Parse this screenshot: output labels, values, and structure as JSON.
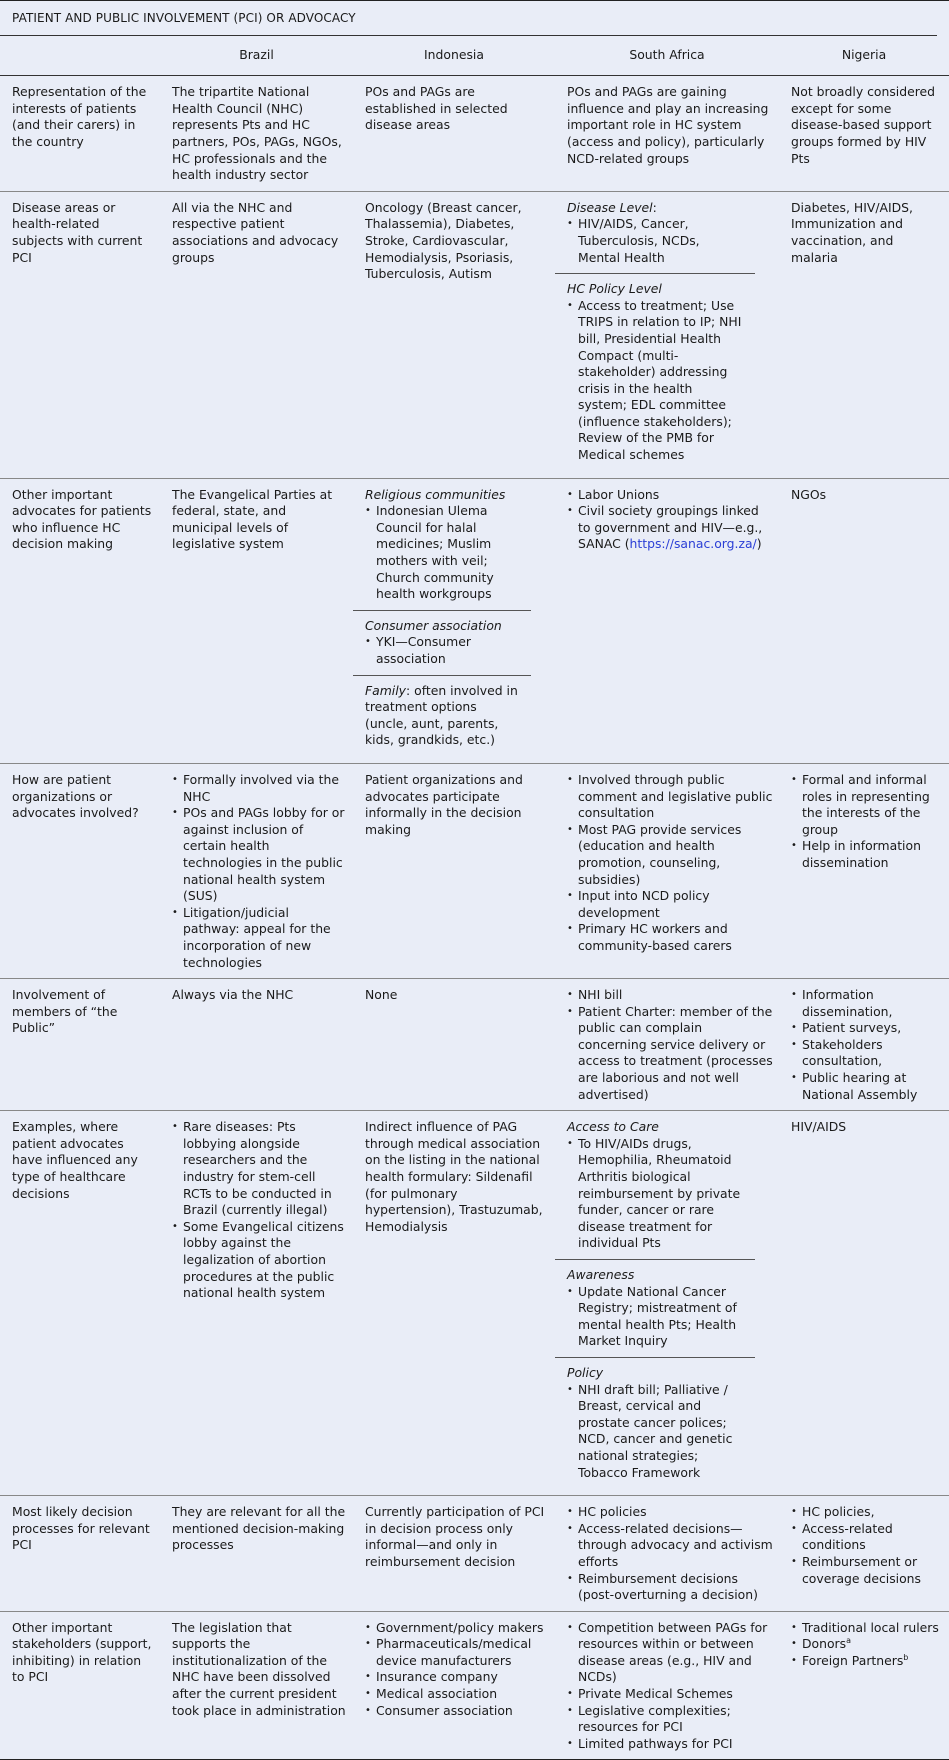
{
  "table": {
    "title": "PATIENT AND PUBLIC INVOLVEMENT (PCI) OR ADVOCACY",
    "columns": [
      "",
      "Brazil",
      "Indonesia",
      "South Africa",
      "Nigeria"
    ],
    "rows": [
      {
        "label": "Representation of the interests of patients (and their carers) in the country",
        "brazil": "The tripartite National Health Council (NHC) represents Pts and HC partners, POs, PAGs, NGOs, HC professionals and the health industry sector",
        "indonesia": "POs and PAGs are established in selected disease areas",
        "south_africa": "POs and PAGs are gaining influence and play an increasing important role in HC system (access and policy), particularly NCD-related groups",
        "nigeria": "Not broadly considered except for some disease-based support groups formed by HIV Pts"
      },
      {
        "label": "Disease areas or health-related subjects with current PCI",
        "brazil": "All via the NHC and respective patient associations and advocacy groups",
        "indonesia": "Oncology (Breast cancer, Thalassemia), Diabetes, Stroke, Cardiovascular, Hemodialysis, Psoriasis, Tuberculosis, Autism",
        "south_africa": {
          "blocks": [
            {
              "heading": "Disease Level",
              "heading_suffix": ":",
              "items": [
                "HIV/AIDS, Cancer, Tuberculosis, NCDs, Mental Health"
              ]
            },
            {
              "heading": "HC Policy Level",
              "heading_suffix": "",
              "items": [
                "Access to treatment; Use TRIPS in relation to IP; NHI bill, Presidential Health Compact (multi-stakeholder) addressing crisis in the health system; EDL committee (influence stakeholders); Review of the PMB for Medical schemes"
              ]
            }
          ]
        },
        "nigeria": "Diabetes, HIV/AIDS, Immunization and vaccination, and malaria"
      },
      {
        "label": "Other important advocates for patients who influence HC decision making",
        "brazil": "The Evangelical Parties at federal, state, and municipal levels of legislative system",
        "indonesia": {
          "blocks": [
            {
              "heading": "Religious communities",
              "items": [
                "Indonesian Ulema Council for halal medicines; Muslim mothers with veil; Church community health workgroups"
              ]
            },
            {
              "heading": "Consumer association",
              "items": [
                "YKI—Consumer association"
              ]
            },
            {
              "heading": "Family",
              "text": ": often involved in treatment options (uncle, aunt, parents, kids, grandkids, etc.)"
            }
          ]
        },
        "south_africa": {
          "items": [
            "Labor Unions",
            "Civil society groupings linked to government and HIV—e.g., SANAC ("
          ],
          "link_text": "https://sanac.org.za/",
          "link_suffix": ")"
        },
        "nigeria": "NGOs"
      },
      {
        "label": "How are patient organizations or advocates involved?",
        "brazil": [
          "Formally involved via the NHC",
          "POs and PAGs lobby for or against inclusion of certain health technologies in the public national health system (SUS)",
          "Litigation/judicial pathway: appeal for the incorporation of new technologies"
        ],
        "indonesia": "Patient organizations and advocates participate informally in the decision making",
        "south_africa": [
          "Involved through public comment and legislative public consultation",
          "Most PAG provide services (education and health promotion, counseling, subsidies)",
          "Input into NCD policy development",
          "Primary HC workers and community-based carers"
        ],
        "nigeria": [
          "Formal and informal roles in representing the interests of the group",
          "Help in information dissemination"
        ]
      },
      {
        "label": "Involvement of members of “the Public”",
        "brazil": "Always via the NHC",
        "indonesia": "None",
        "south_africa": [
          "NHI bill",
          "Patient Charter: member of the public can complain concerning service delivery or access to treatment (processes are laborious and not well advertised)"
        ],
        "nigeria": [
          "Information dissemination,",
          "Patient surveys,",
          "Stakeholders consultation,",
          "Public hearing at National Assembly"
        ]
      },
      {
        "label": "Examples, where patient advocates have influenced any type of healthcare decisions",
        "brazil": [
          "Rare diseases: Pts lobbying alongside researchers and the industry for stem-cell RCTs to be conducted in Brazil (currently illegal)",
          "Some Evangelical citizens lobby against the legalization of abortion procedures at the public national health system"
        ],
        "indonesia": "Indirect influence of PAG through medical association on the listing in the national health formulary: Sildenafil (for pulmonary hypertension), Trastuzumab, Hemodialysis",
        "south_africa": {
          "blocks": [
            {
              "heading": "Access to Care",
              "items": [
                "To HIV/AIDs drugs, Hemophilia, Rheumatoid Arthritis biological reimbursement by private funder, cancer or rare disease treatment for individual Pts"
              ]
            },
            {
              "heading": "Awareness",
              "items": [
                "Update National Cancer Registry; mistreatment of mental health Pts; Health Market Inquiry"
              ]
            },
            {
              "heading": "Policy",
              "items": [
                "NHI draft bill; Palliative / Breast, cervical and prostate cancer polices; NCD, cancer and genetic national strategies; Tobacco Framework"
              ]
            }
          ]
        },
        "nigeria": "HIV/AIDS"
      },
      {
        "label": "Most likely decision processes for relevant PCI",
        "brazil": "They are relevant for all the mentioned decision-making processes",
        "indonesia": "Currently participation of PCI in decision process only informal—and only in reimbursement decision",
        "south_africa": [
          "HC policies",
          "Access-related decisions—through advocacy and activism efforts",
          "Reimbursement decisions (post-overturning a decision)"
        ],
        "nigeria": [
          "HC policies,",
          "Access-related conditions",
          "Reimbursement or coverage decisions"
        ]
      },
      {
        "label": "Other important stakeholders (support, inhibiting) in relation to PCI",
        "brazil": "The legislation that supports the institutionalization of the NHC have been dissolved after the current president took place in administration",
        "indonesia": [
          "Government/policy makers",
          "Pharmaceuticals/medical device manufacturers",
          "Insurance company",
          "Medical association",
          "Consumer association"
        ],
        "south_africa": [
          "Competition between PAGs for resources within or between disease areas (e.g., HIV and NCDs)",
          "Private Medical Schemes",
          "Legislative complexities; resources for PCI",
          "Limited pathways for PCI"
        ],
        "nigeria": {
          "items": [
            "Traditional local rulers",
            "Donors",
            "Foreign Partners"
          ],
          "footnotes": [
            "",
            "a",
            "b"
          ]
        }
      }
    ]
  }
}
